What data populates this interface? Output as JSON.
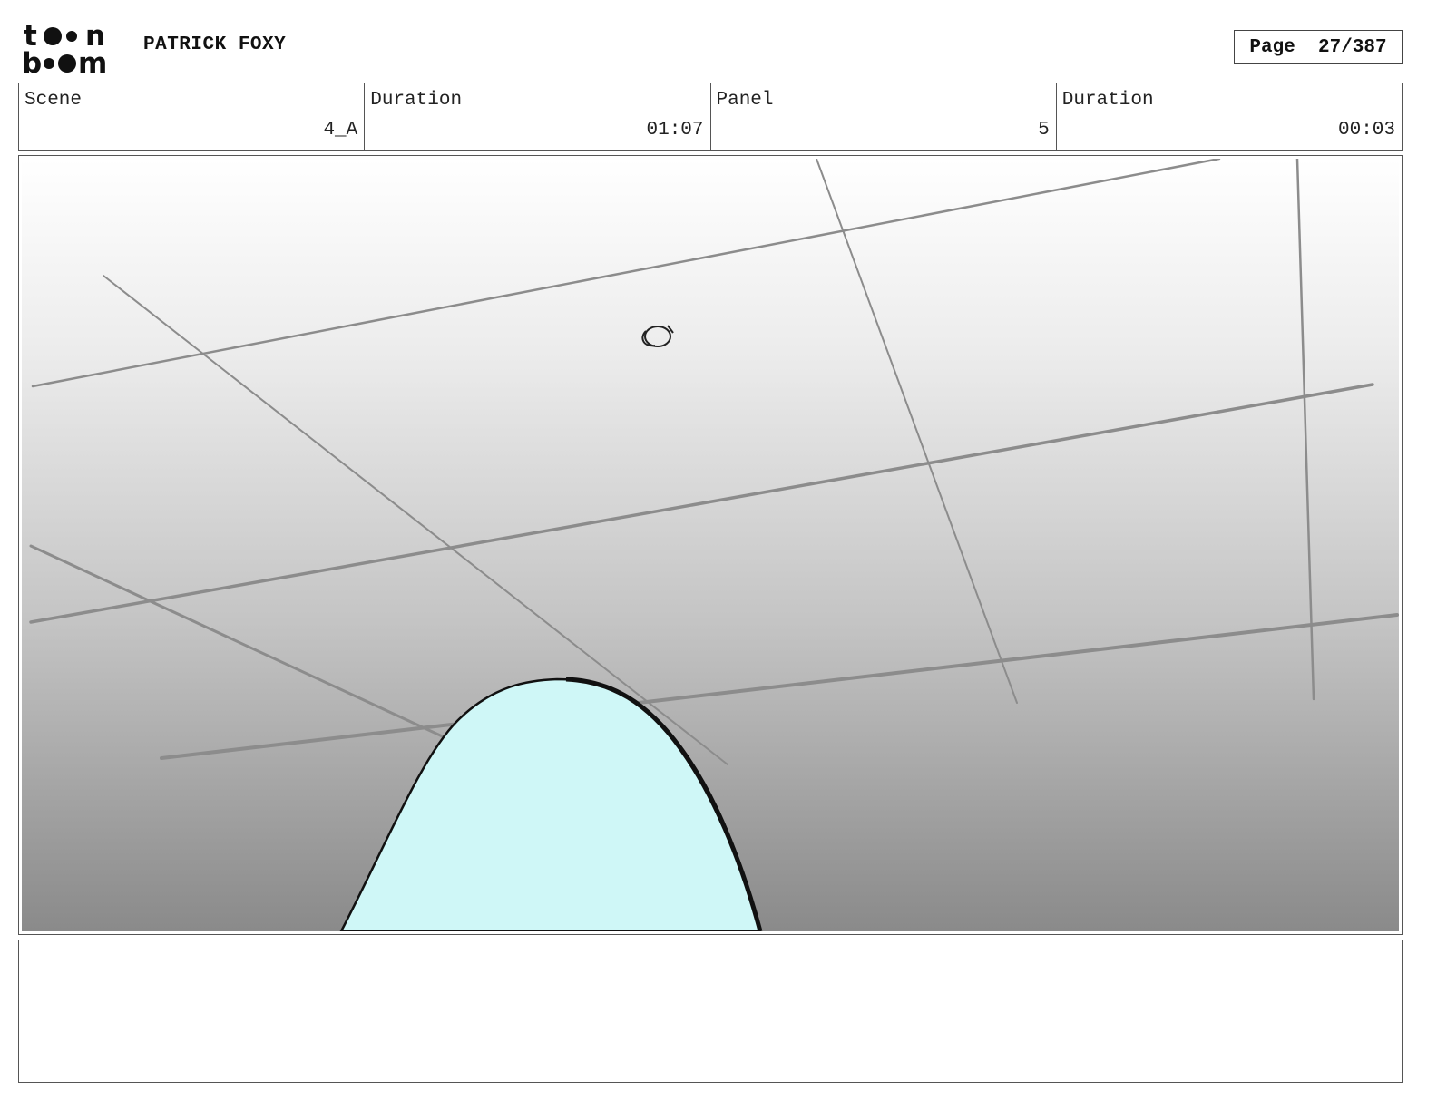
{
  "header": {
    "logo_text_top": "toon",
    "logo_text_bottom": "boom",
    "project_title": "PATRICK FOXY",
    "page_label": "Page  27/387"
  },
  "info_fields": [
    {
      "label": "Scene",
      "value": "4_A"
    },
    {
      "label": "Duration",
      "value": "01:07"
    },
    {
      "label": "Panel",
      "value": "5"
    },
    {
      "label": "Duration",
      "value": "00:03"
    }
  ],
  "panel": {
    "background_gradient": [
      "#ffffff",
      "#8a8a8a"
    ],
    "shape_fill": "#cff7f7",
    "line_color": "#888888"
  },
  "notes": {
    "text": ""
  }
}
